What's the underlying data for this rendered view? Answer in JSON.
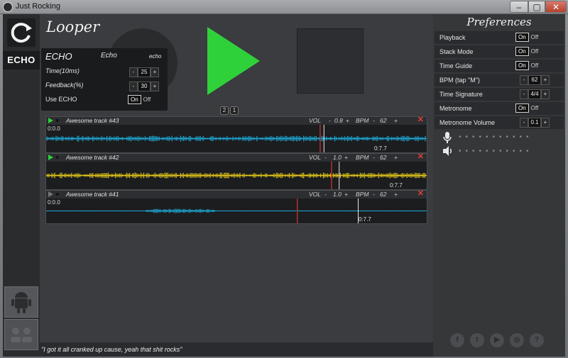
{
  "window": {
    "title": "Just Rocking",
    "min_icon": "minimize-icon",
    "max_icon": "maximize-icon",
    "close_icon": "close-icon"
  },
  "sidebar": {
    "refresh_icon": "refresh-icon",
    "echo_tab": "ECHO",
    "android_icon": "android-icon",
    "group_icon": "people-icon"
  },
  "looper": {
    "title": "Looper",
    "page_buttons": [
      "2",
      "1"
    ]
  },
  "echo": {
    "title": "ECHO",
    "tab_echo": "Echo",
    "tab_echo_small": "echo",
    "time_label": "Time(10ms)",
    "time_value": "25",
    "feedback_label": "Feedback(%)",
    "feedback_value": "30",
    "use_label": "Use ECHO",
    "on": "On",
    "off": "Off"
  },
  "tracks": [
    {
      "name": "Awesome track #43",
      "vol": "0.8",
      "bpm": "62",
      "start": "0:0.0",
      "end": "0:7.7",
      "wave_color": "#1ea9d6",
      "playing": true,
      "progress": 0.72,
      "playhead": 0.73
    },
    {
      "name": "Awesome track #42",
      "vol": "1.0",
      "bpm": "62",
      "start": "",
      "end": "0:7.7",
      "wave_color": "#e3c81a",
      "playing": true,
      "progress": 0.75,
      "playhead": 0.77
    },
    {
      "name": "Awesome track #41",
      "vol": "1.0",
      "bpm": "62",
      "start": "0:0.0",
      "end": "0:7.7",
      "wave_color": "#1ea9d6",
      "playing": false,
      "progress": 0.66,
      "playhead": 0.82
    }
  ],
  "track_labels": {
    "vol": "VOL",
    "bpm": "BPM",
    "minus": "-",
    "plus": "+"
  },
  "quote": "\"I got it all cranked up cause, yeah that shit rocks\"",
  "preferences": {
    "title": "Preferences",
    "rows": [
      {
        "label": "Playback",
        "type": "toggle",
        "on": "On",
        "off": "Off"
      },
      {
        "label": "Stack Mode",
        "type": "toggle",
        "on": "On",
        "off": "Off"
      },
      {
        "label": "Time Guide",
        "type": "toggle",
        "on": "On",
        "off": "Off"
      },
      {
        "label": "BPM (tap \"M\")",
        "type": "stepper",
        "value": "62"
      },
      {
        "label": "Time Signature",
        "type": "stepper",
        "value": "4/4"
      },
      {
        "label": "Metronome",
        "type": "toggle",
        "on": "On",
        "off": "Off"
      },
      {
        "label": "Metronome Volume",
        "type": "stepper",
        "value": "0.1"
      }
    ],
    "mic_icon": "microphone-icon",
    "speaker_icon": "speaker-icon",
    "social_icons": [
      "facebook-icon",
      "twitter-icon",
      "youtube-icon",
      "instagram-icon",
      "help-icon"
    ]
  },
  "colors": {
    "play_green": "#2fd13a",
    "accent_red": "#e0413a"
  }
}
